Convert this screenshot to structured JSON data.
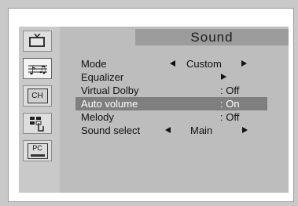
{
  "menu": {
    "title": "Sound",
    "items": [
      {
        "label": "Mode",
        "value": "Custom",
        "arrows": "both"
      },
      {
        "label": "Equalizer",
        "value": "",
        "arrows": "right"
      },
      {
        "label": "Virtual Dolby",
        "value": ": Off",
        "arrows": "none"
      },
      {
        "label": "Auto volume",
        "value": ": On",
        "arrows": "none",
        "selected": true
      },
      {
        "label": "Melody",
        "value": ": Off",
        "arrows": "none"
      },
      {
        "label": "Sound select",
        "value": "Main",
        "arrows": "both"
      }
    ]
  },
  "sidebar": {
    "icons": [
      {
        "name": "picture-icon",
        "text": ""
      },
      {
        "name": "sound-icon",
        "text": "",
        "active": true
      },
      {
        "name": "channel-icon",
        "text": "CH"
      },
      {
        "name": "setup-icon",
        "text": ""
      },
      {
        "name": "pc-icon",
        "text": "PC"
      }
    ]
  },
  "colors": {
    "highlight": "#7f7f7f",
    "title_bar": "#9c9c9c",
    "panel": "#bdbdbd"
  }
}
